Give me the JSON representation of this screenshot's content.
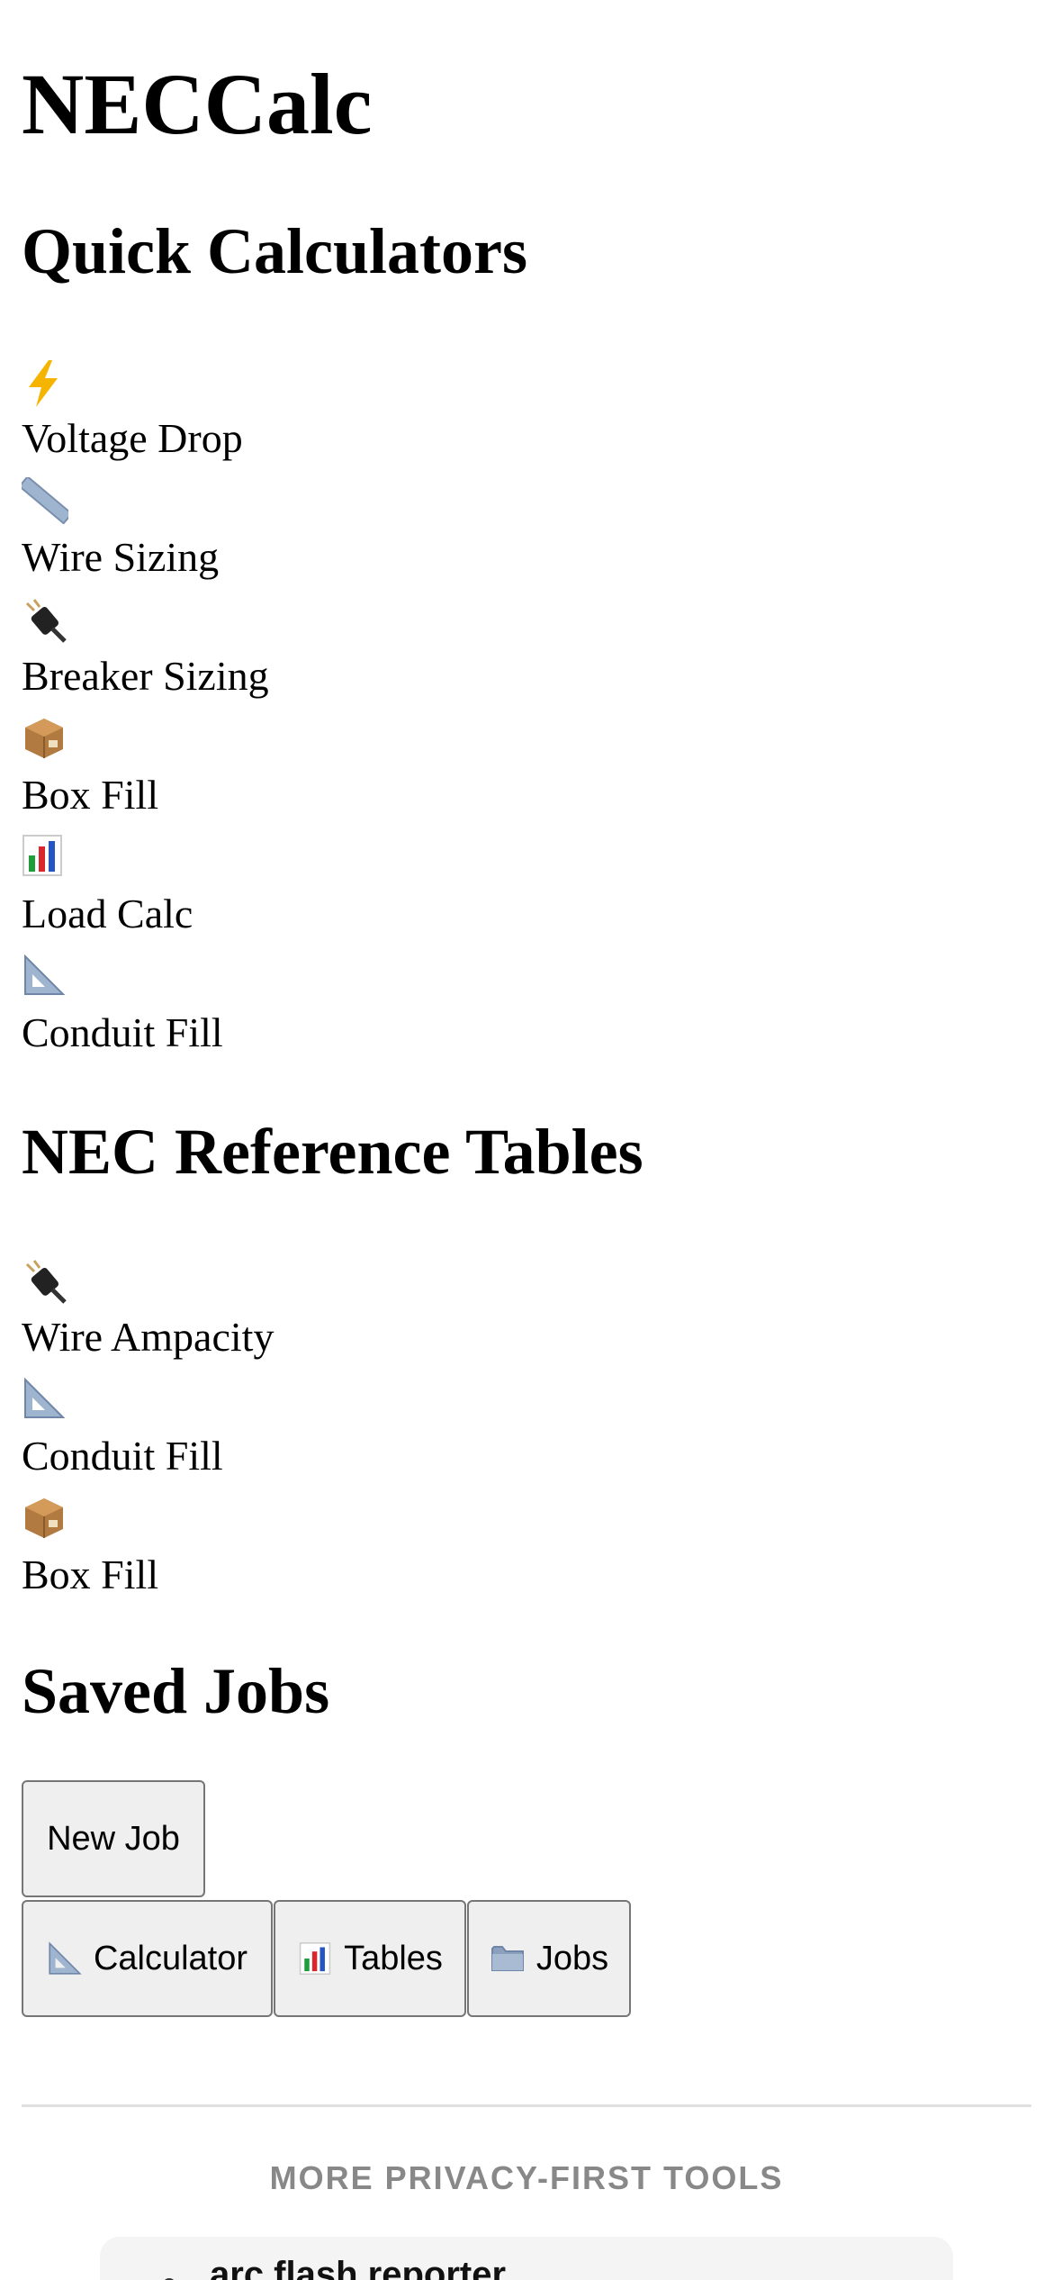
{
  "app": {
    "title": "NECCalc"
  },
  "quick_calculators": {
    "heading": "Quick Calculators",
    "items": [
      {
        "icon": "lightning-icon",
        "label": "Voltage Drop"
      },
      {
        "icon": "ruler-icon",
        "label": "Wire Sizing"
      },
      {
        "icon": "plug-icon",
        "label": "Breaker Sizing"
      },
      {
        "icon": "box-icon",
        "label": "Box Fill"
      },
      {
        "icon": "bar-chart-icon",
        "label": "Load Calc"
      },
      {
        "icon": "triangle-ruler-icon",
        "label": "Conduit Fill"
      }
    ]
  },
  "reference_tables": {
    "heading": "NEC Reference Tables",
    "items": [
      {
        "icon": "plug-icon",
        "label": "Wire Ampacity"
      },
      {
        "icon": "triangle-ruler-icon",
        "label": "Conduit Fill"
      },
      {
        "icon": "box-icon",
        "label": "Box Fill"
      }
    ]
  },
  "saved_jobs": {
    "heading": "Saved Jobs",
    "new_job_label": "New Job"
  },
  "bottom_nav": {
    "items": [
      {
        "icon": "triangle-ruler-icon",
        "label": "Calculator"
      },
      {
        "icon": "bar-chart-icon",
        "label": "Tables"
      },
      {
        "icon": "folder-icon",
        "label": "Jobs"
      }
    ]
  },
  "more_tools": {
    "heading": "MORE PRIVACY-FIRST TOOLS",
    "items": [
      {
        "name": "arc flash reporter"
      }
    ]
  },
  "colors": {
    "lightning": "#f5b400",
    "button_bg": "#efefef",
    "button_border": "#767676",
    "muted_text": "#888888",
    "card_bg": "#f4f4f4"
  }
}
